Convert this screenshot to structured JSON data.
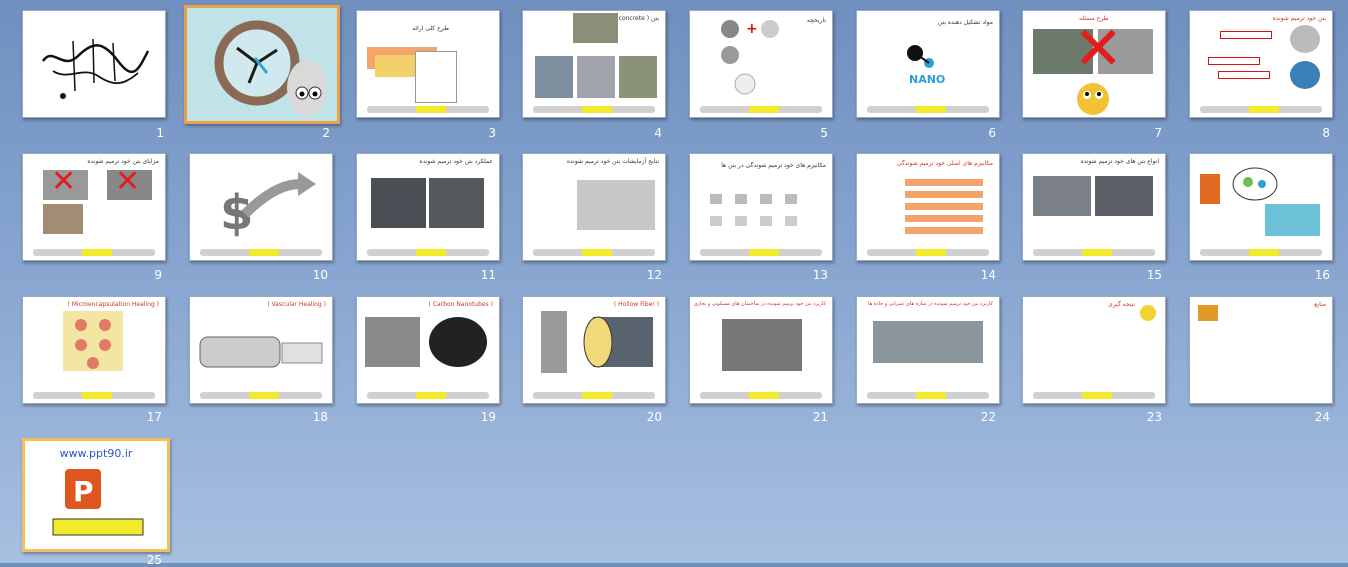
{
  "slides": [
    {
      "num": "1",
      "title": "بسم الله الرحمن الرحيم"
    },
    {
      "num": "2",
      "title": ""
    },
    {
      "num": "3",
      "title": "طرح کلی ارائه"
    },
    {
      "num": "4",
      "title": "بتن ( concrete )"
    },
    {
      "num": "5",
      "title": "تاریخچه"
    },
    {
      "num": "6",
      "title": "مواد تشکیل دهنده بتن",
      "label": "NANO"
    },
    {
      "num": "7",
      "title": "طرح مسئله"
    },
    {
      "num": "8",
      "title": "بتن خود ترمیم شونده"
    },
    {
      "num": "9",
      "title": "مزایای بتن خود ترمیم شونده"
    },
    {
      "num": "10",
      "title": ""
    },
    {
      "num": "11",
      "title": "عملکرد بتن خود ترمیم شونده"
    },
    {
      "num": "12",
      "title": "نتایج آزمایشات بتن خود ترمیم شونده"
    },
    {
      "num": "13",
      "title": "مکانیزم های خود ترمیم شوندگی در بتن ها"
    },
    {
      "num": "14",
      "title": "مکانیزم های اصلی خود ترمیم شوندگی"
    },
    {
      "num": "15",
      "title": "انواع بتن های خود ترمیم شونده"
    },
    {
      "num": "16",
      "title": ""
    },
    {
      "num": "17",
      "title": "( Microencapsulation Healing )"
    },
    {
      "num": "18",
      "title": "( Vascular Healing )"
    },
    {
      "num": "19",
      "title": "( Carbon Nanotubes )"
    },
    {
      "num": "20",
      "title": "( Hollow Fiber )"
    },
    {
      "num": "21",
      "title": "کاربرد بتن خود ترمیم شونده در ساختمان های مسکونی و تجاری"
    },
    {
      "num": "22",
      "title": "کاربرد بتن خود ترمیم شونده در سازه های عمرانی و جاده ها"
    },
    {
      "num": "23",
      "title": "نتیجه گیری"
    },
    {
      "num": "24",
      "title": "منابع"
    },
    {
      "num": "25",
      "title": "",
      "url": "www.ppt90.ir"
    }
  ],
  "colors": {
    "background": "#7f9dca",
    "selected_border": "#e8a049",
    "accent_red": "#e21d1d",
    "footer_yellow": "#f2ea2b"
  }
}
